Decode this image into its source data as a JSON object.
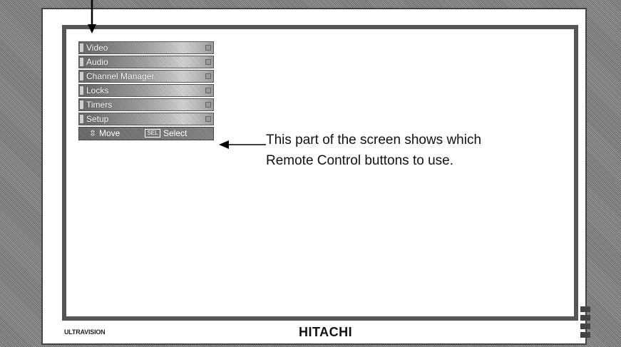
{
  "menu": {
    "items": [
      {
        "label": "Video",
        "icon": "menu-marker-icon"
      },
      {
        "label": "Audio",
        "icon": "menu-marker-icon"
      },
      {
        "label": "Channel Manager",
        "icon": "menu-marker-icon"
      },
      {
        "label": "Locks",
        "icon": "menu-marker-icon"
      },
      {
        "label": "Timers",
        "icon": "menu-marker-icon"
      },
      {
        "label": "Setup",
        "icon": "menu-marker-icon"
      }
    ],
    "help": {
      "move_icon": "⇳",
      "move_label": "Move",
      "select_icon": "SEL",
      "select_label": "Select"
    }
  },
  "callout": {
    "line1": "This part of the screen shows which",
    "line2": "Remote Control buttons to use."
  },
  "branding": {
    "left": "ULTRAVISION",
    "center": "HITACHI"
  },
  "colors": {
    "screen_border": "#555555",
    "menu_bar": "#8a8a8a",
    "text": "#111111"
  }
}
